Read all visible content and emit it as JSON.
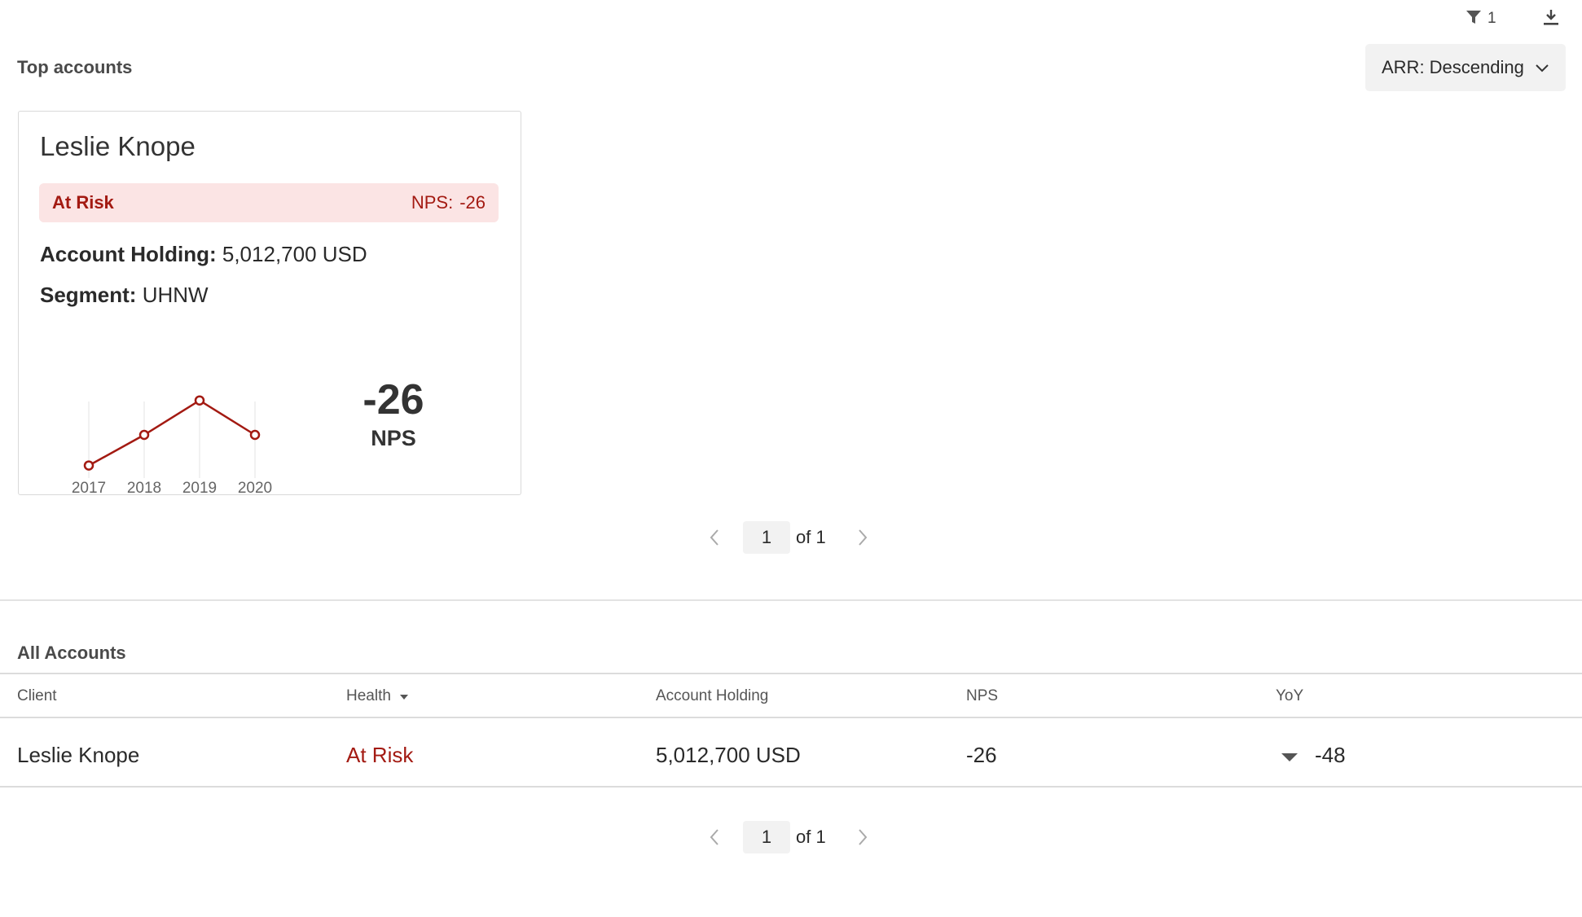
{
  "toolbar": {
    "filter_count": "1",
    "filter_icon": "filter-icon",
    "download_icon": "download-icon"
  },
  "top_accounts": {
    "title": "Top accounts",
    "sort_label": "ARR: Descending",
    "card": {
      "name": "Leslie Knope",
      "status": "At Risk",
      "nps_prefix": "NPS:",
      "nps_value": "-26",
      "holding_label": "Account Holding:",
      "holding_value": "5,012,700 USD",
      "segment_label": "Segment:",
      "segment_value": "UHNW",
      "big_nps_value": "-26",
      "big_nps_label": "NPS"
    },
    "pager": {
      "page": "1",
      "of": "of 1"
    }
  },
  "chart_data": {
    "type": "line",
    "title": "",
    "xlabel": "",
    "ylabel": "",
    "categories": [
      "2017",
      "2018",
      "2019",
      "2020"
    ],
    "values": [
      0.1,
      0.5,
      0.95,
      0.5
    ],
    "grid": true,
    "color": "#a31a12"
  },
  "all_accounts": {
    "title": "All Accounts",
    "columns": [
      "Client",
      "Health",
      "Account Holding",
      "NPS",
      "YoY"
    ],
    "rows": [
      {
        "client": "Leslie Knope",
        "health": "At Risk",
        "holding": "5,012,700 USD",
        "nps": "-26",
        "yoy": "-48",
        "yoy_direction": "down"
      }
    ],
    "pager": {
      "page": "1",
      "of": "of 1"
    }
  },
  "colors": {
    "risk": "#a31a12",
    "risk_bg": "#fbe4e4"
  }
}
